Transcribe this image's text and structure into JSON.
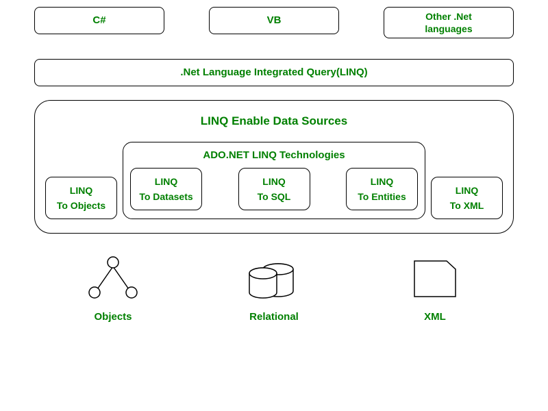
{
  "languages": {
    "csharp": "C#",
    "vb": "VB",
    "other": "Other .Net\nlanguages"
  },
  "linq_bar": ".Net Language Integrated Query(LINQ)",
  "data_sources": {
    "title": "LINQ Enable Data Sources",
    "ado_title": "ADO.NET LINQ Technologies",
    "providers": {
      "objects": {
        "line1": "LINQ",
        "line2": "To Objects"
      },
      "datasets": {
        "line1": "LINQ",
        "line2": "To Datasets"
      },
      "sql": {
        "line1": "LINQ",
        "line2": "To SQL"
      },
      "entities": {
        "line1": "LINQ",
        "line2": "To Entities"
      },
      "xml": {
        "line1": "LINQ",
        "line2": "To XML"
      }
    }
  },
  "stores": {
    "objects": "Objects",
    "relational": "Relational",
    "xml": "XML"
  }
}
